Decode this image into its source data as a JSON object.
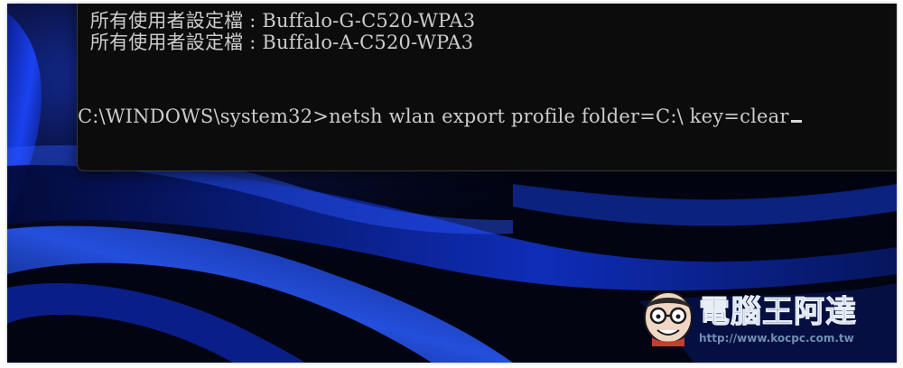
{
  "terminal": {
    "lines": [
      "  所有使用者設定檔 : Buffalo-G-C520-WPA3",
      "  所有使用者設定檔 : Buffalo-A-C520-WPA3",
      "C:\\WINDOWS\\system32>netsh wlan export profile folder=C:\\ key=clear"
    ]
  },
  "watermark": {
    "title": "電腦王阿達",
    "url": "http://www.kocpc.com.tw",
    "icon": "cartoon-face-logo"
  },
  "colors": {
    "terminal_bg": "#0c0c0c",
    "terminal_text": "#cccccc",
    "wallpaper_dark": "#020412",
    "wallpaper_blue": "#1a4cff",
    "watermark": "#6f8fb4"
  }
}
